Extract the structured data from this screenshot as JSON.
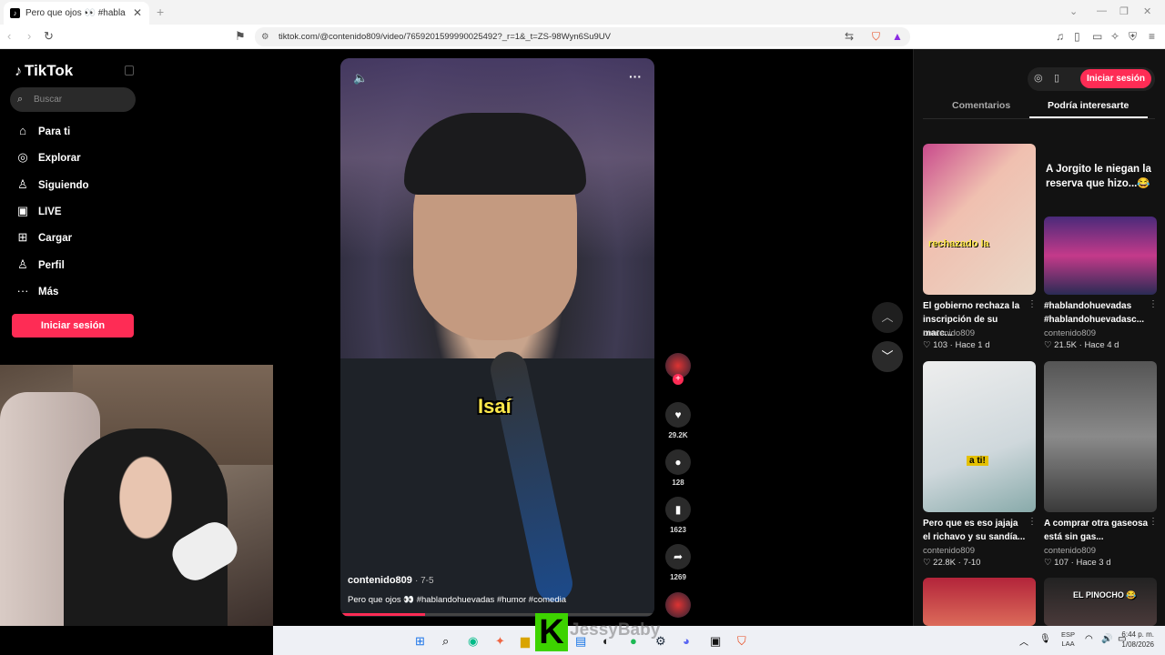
{
  "browser": {
    "tab_title": "Pero que ojos 👀 #hablando",
    "tab_close": "✕",
    "new_tab": "+",
    "url": "tiktok.com/@contenido809/video/7659201599990025492?_r=1&_t=ZS-98Wyn6Su9UV"
  },
  "sidebar": {
    "logo": "TikTok",
    "search_placeholder": "Buscar",
    "items": [
      {
        "label": "Para ti",
        "icon": "home-icon"
      },
      {
        "label": "Explorar",
        "icon": "compass-icon"
      },
      {
        "label": "Siguiendo",
        "icon": "following-icon"
      },
      {
        "label": "LIVE",
        "icon": "live-icon"
      },
      {
        "label": "Cargar",
        "icon": "upload-icon"
      },
      {
        "label": "Perfil",
        "icon": "profile-icon"
      },
      {
        "label": "Más",
        "icon": "more-icon"
      }
    ],
    "login_label": "Iniciar sesión"
  },
  "video": {
    "caption": "Isaí",
    "username": "contenido809",
    "date": "· 7-5",
    "description": "Pero que ojos 👀 #hablandohuevadas #humor #comedia",
    "progress": 0.27
  },
  "actions": {
    "likes": "29.2K",
    "comments": "128",
    "saves": "1623",
    "shares": "1269"
  },
  "right_panel": {
    "login_label": "Iniciar sesión",
    "tabs": [
      "Comentarios",
      "Podría interesarte"
    ],
    "active_tab": "Podría interesarte",
    "featured_title": "A Jorgito le niegan la reserva que hizo...😂",
    "cards": [
      {
        "title": "El gobierno rechaza la inscripción de su marc...",
        "user": "contenido809",
        "likes": "103",
        "age": "Hace 1 d",
        "overlay": "rechazado la"
      },
      {
        "title": "#hablandohuevadas #hablandohuevadasc...",
        "user": "contenido809",
        "likes": "21.5K",
        "age": "Hace 4 d",
        "overlay": ""
      },
      {
        "title": "Pero que es eso jajaja el richavo y su sandía...",
        "user": "contenido809",
        "likes": "22.8K",
        "age": "7-10",
        "overlay": "a ti!"
      },
      {
        "title": "A comprar otra gaseosa está sin gas...",
        "user": "contenido809",
        "likes": "107",
        "age": "Hace 3 d",
        "overlay": ""
      },
      {
        "title": "",
        "user": "",
        "likes": "",
        "age": "",
        "overlay": ""
      },
      {
        "title": "",
        "user": "",
        "likes": "",
        "age": "",
        "overlay": "EL PINOCHO 😂"
      }
    ]
  },
  "taskbar": {
    "lang": "ESP",
    "lang2": "LAA",
    "time": "6:44 p. m.",
    "date": "1/08/2026",
    "overlay_letter": "K",
    "overlay_name": "JessyBaby"
  }
}
